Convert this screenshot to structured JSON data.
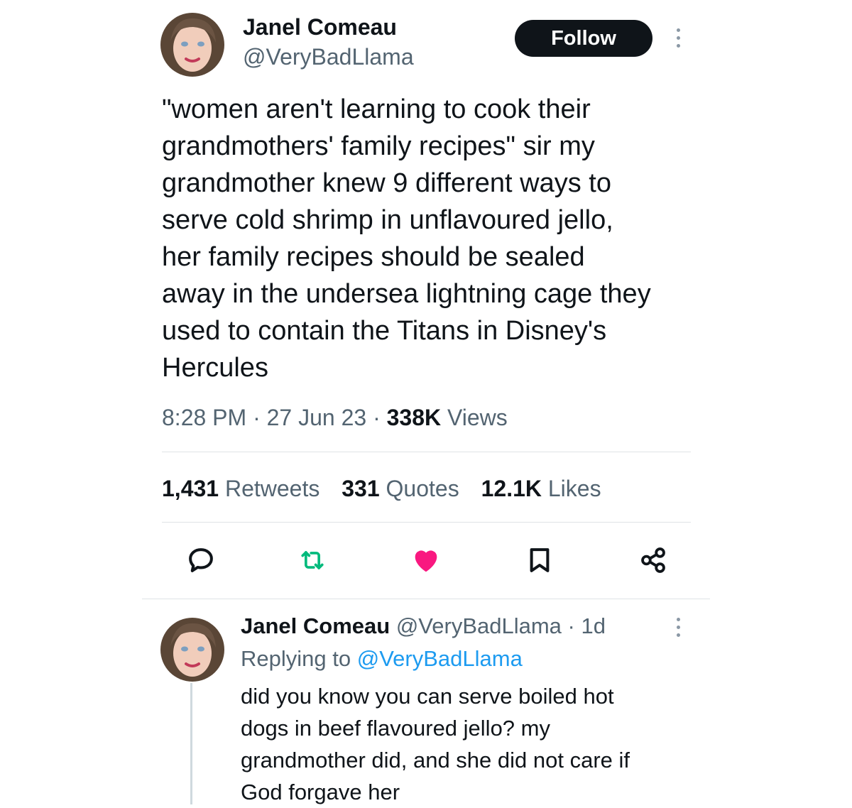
{
  "tweet": {
    "author_name": "Janel Comeau",
    "author_handle": "@VeryBadLlama",
    "follow_label": "Follow",
    "text": "\"women aren't learning to cook their\ngrandmothers' family recipes\" sir my\ngrandmother knew 9 different ways to\nserve cold shrimp in unflavoured jello,\nher family recipes should be sealed\naway in the undersea lightning cage they\nused to contain the Titans in Disney's\nHercules",
    "time": "8:28 PM",
    "sep": " · ",
    "date": "27 Jun 23",
    "views_count": "338K",
    "views_label": "Views",
    "stats": [
      {
        "count": "1,431",
        "label": "Retweets"
      },
      {
        "count": "331",
        "label": "Quotes"
      },
      {
        "count": "12.1K",
        "label": "Likes"
      }
    ],
    "actions": [
      {
        "icon": "reply-icon"
      },
      {
        "icon": "retweet-icon",
        "color": "#00ba7c"
      },
      {
        "icon": "like-icon",
        "color": "#f91880"
      },
      {
        "icon": "bookmark-icon"
      },
      {
        "icon": "share-icon"
      }
    ]
  },
  "reply": {
    "author_name": "Janel Comeau",
    "author_handle": "@VeryBadLlama",
    "age": "· 1d",
    "replying_label": "Replying to",
    "replying_to": "@VeryBadLlama",
    "text": "did you know you can serve boiled hot\ndogs in beef flavoured jello? my\ngrandmother did, and she did not care if\nGod forgave her"
  },
  "colors": {
    "text": "#0f1419",
    "secondary": "#536471",
    "link": "#1d9bf0",
    "like": "#f91880",
    "retweet": "#00ba7c"
  }
}
